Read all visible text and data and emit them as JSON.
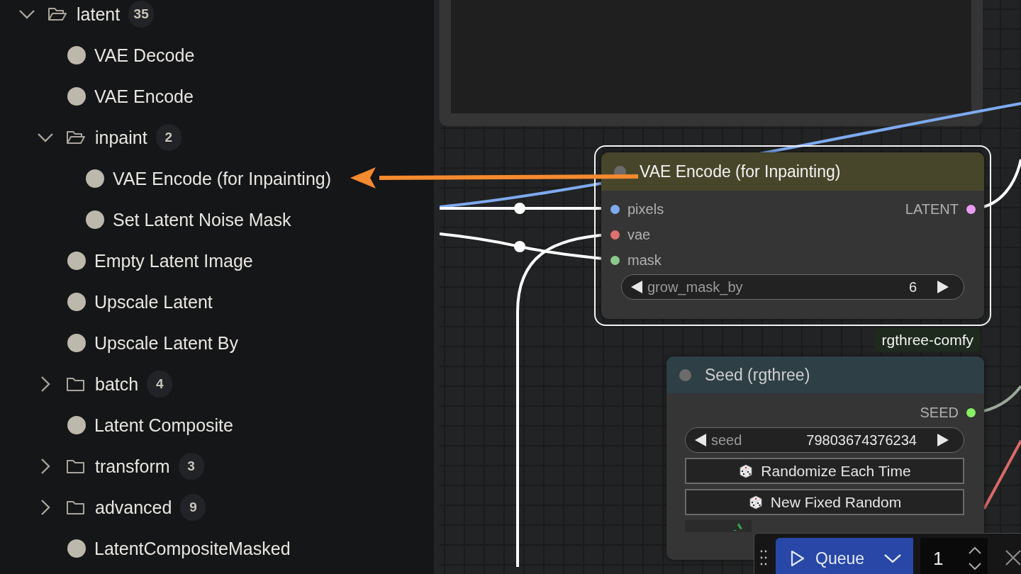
{
  "sidebar": {
    "tree": [
      {
        "kind": "folder",
        "label": "latent",
        "count": "35",
        "expanded": true,
        "children": [
          {
            "kind": "node",
            "label": "VAE Decode"
          },
          {
            "kind": "node",
            "label": "VAE Encode"
          },
          {
            "kind": "folder",
            "label": "inpaint",
            "count": "2",
            "expanded": true,
            "children": [
              {
                "kind": "node",
                "label": "VAE Encode (for Inpainting)"
              },
              {
                "kind": "node",
                "label": "Set Latent Noise Mask"
              }
            ]
          },
          {
            "kind": "node",
            "label": "Empty Latent Image"
          },
          {
            "kind": "node",
            "label": "Upscale Latent"
          },
          {
            "kind": "node",
            "label": "Upscale Latent By"
          },
          {
            "kind": "folder",
            "label": "batch",
            "count": "4",
            "expanded": false
          },
          {
            "kind": "node",
            "label": "Latent Composite"
          },
          {
            "kind": "folder",
            "label": "transform",
            "count": "3",
            "expanded": false
          },
          {
            "kind": "folder",
            "label": "advanced",
            "count": "9",
            "expanded": false
          },
          {
            "kind": "node",
            "label": "LatentCompositeMasked"
          }
        ]
      }
    ]
  },
  "canvas": {
    "nodes": [
      {
        "kind": "vae",
        "title": "VAE Encode (for Inpainting)",
        "selected": true,
        "inputs": [
          {
            "name": "pixels",
            "color": "#7eaaf0"
          },
          {
            "name": "vae",
            "color": "#e07070"
          },
          {
            "name": "mask",
            "color": "#8cc88c"
          }
        ],
        "outputs": [
          {
            "name": "LATENT",
            "color": "#e89cf0"
          }
        ],
        "widgets": [
          {
            "kind": "number",
            "label": "grow_mask_by",
            "value": "6"
          }
        ]
      },
      {
        "kind": "seed",
        "title": "Seed (rgthree)",
        "selected": false,
        "badge": "rgthree-comfy",
        "outputs": [
          {
            "name": "SEED",
            "color": "#88ee66"
          }
        ],
        "widgets": [
          {
            "kind": "number",
            "label": "seed",
            "value": "79803674376234"
          },
          {
            "kind": "button",
            "label": "Randomize Each Time"
          },
          {
            "kind": "button",
            "label": "New Fixed Random"
          },
          {
            "kind": "button"
          }
        ]
      }
    ]
  },
  "queue_bar": {
    "label": "Queue",
    "count": "1"
  }
}
